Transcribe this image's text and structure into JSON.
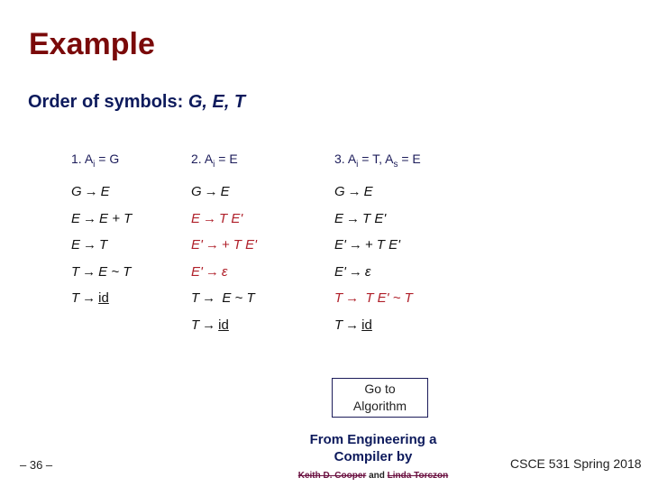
{
  "slide": {
    "title": "Example",
    "subtitle": {
      "prefix": "Order of symbols: ",
      "symbols": "G, E, T"
    },
    "columns": [
      {
        "header": {
          "num": "1.",
          "lhs": "A",
          "sub": "i",
          "rest": " = G"
        },
        "rules": [
          {
            "lhs": "G",
            "rhs": "E",
            "highlight": false
          },
          {
            "lhs": "E",
            "rhs": "E + T",
            "highlight": false
          },
          {
            "lhs": "E",
            "rhs": "T",
            "highlight": false
          },
          {
            "lhs": "T",
            "rhs": "E ~ T",
            "highlight": false
          },
          {
            "lhs": "T",
            "rhs": "id",
            "highlight": false,
            "underline": true
          }
        ]
      },
      {
        "header": {
          "num": "2.",
          "lhs": "A",
          "sub": "i",
          "rest": " = E"
        },
        "rules": [
          {
            "lhs": "G",
            "rhs": "E",
            "highlight": false
          },
          {
            "lhs": "E",
            "rhs": "T E'",
            "highlight": true
          },
          {
            "lhs": "E'",
            "rhs": "+ T E'",
            "highlight": true
          },
          {
            "lhs": "E'",
            "rhs": "ε",
            "highlight": true
          },
          {
            "lhs": "T",
            "rhs": " E ~ T",
            "highlight": false
          },
          {
            "lhs": "T",
            "rhs": "id",
            "highlight": false,
            "underline": true
          }
        ]
      },
      {
        "header": {
          "num": "3.",
          "lhs": "A",
          "sub": "i",
          "rest": " = T, A",
          "sub2": "s",
          "rest2": " = E"
        },
        "rules": [
          {
            "lhs": "G",
            "rhs": "E",
            "highlight": false
          },
          {
            "lhs": "E",
            "rhs": "T E'",
            "highlight": false
          },
          {
            "lhs": "E'",
            "rhs": "+ T E'",
            "highlight": false
          },
          {
            "lhs": "E'",
            "rhs": "ε",
            "highlight": false
          },
          {
            "lhs": "T",
            "rhs": " T E' ~ T",
            "highlight": true
          },
          {
            "lhs": "T",
            "rhs": "id",
            "highlight": false,
            "underline": true
          }
        ]
      }
    ],
    "arrow_glyph": "→",
    "goto_button": {
      "line1": "Go to",
      "line2": "Algorithm"
    },
    "footer": {
      "page": "– 36 –",
      "source_line1": "From Engineering a",
      "source_line2": "Compiler by",
      "author1": "Keith D. Cooper",
      "and": " and ",
      "author2": "Linda Torczon",
      "course": "CSCE 531 Spring 2018"
    },
    "colors": {
      "title": "#7a0a0a",
      "subtitle": "#0d1a5c",
      "highlight": "#b0202a"
    }
  }
}
